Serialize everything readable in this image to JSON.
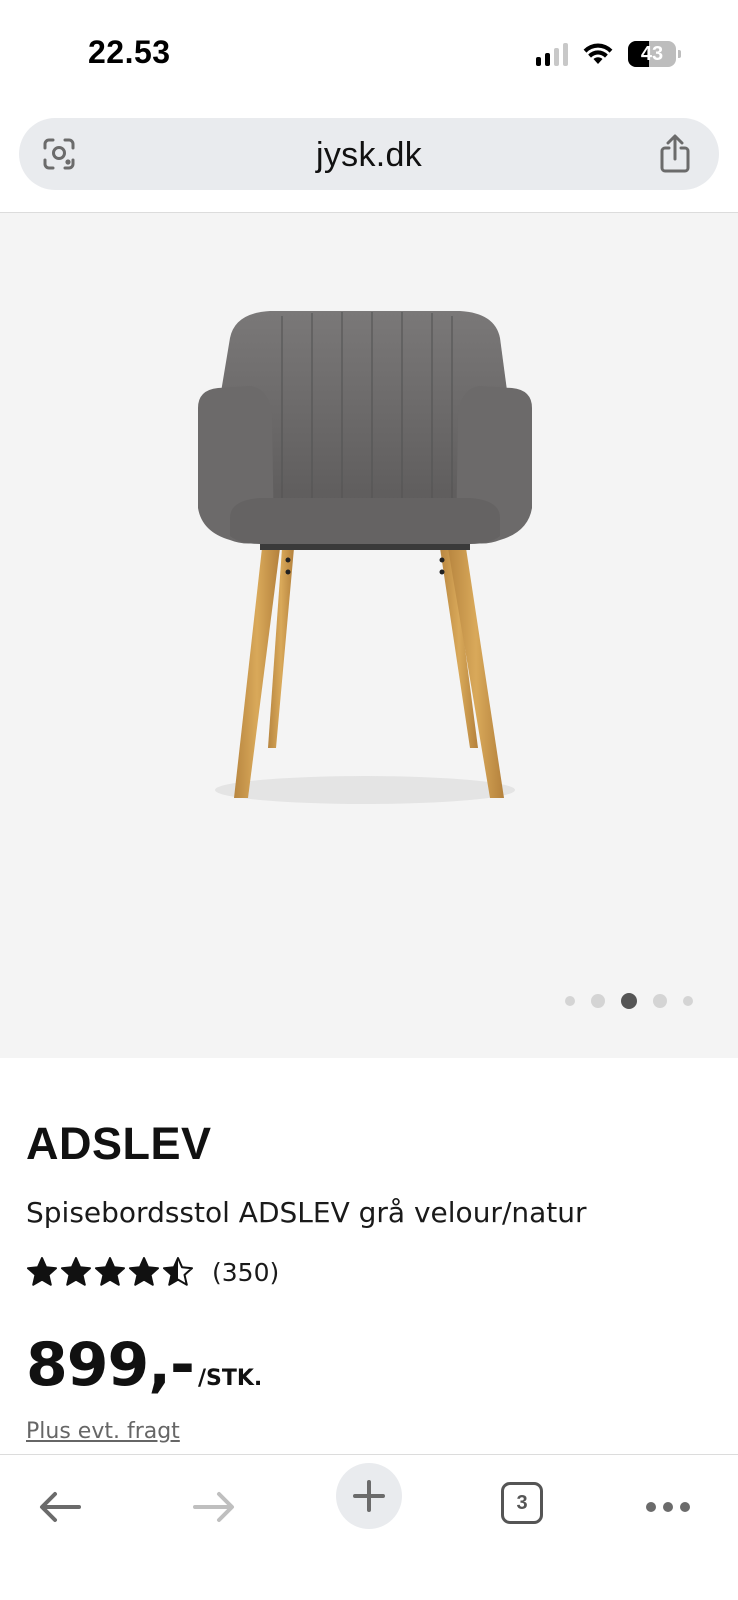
{
  "status_bar": {
    "time": "22.53",
    "battery": "43",
    "battery_level": 0.43,
    "signal_bars_active": 2
  },
  "browser": {
    "url": "jysk.dk",
    "left_icon": "visual-search-icon",
    "right_icon": "share-icon",
    "open_tabs": "3"
  },
  "gallery": {
    "image_count": 5,
    "active_index": 2
  },
  "product": {
    "name": "ADSLEV",
    "description": "Spisebordsstol ADSLEV grå velour/natur",
    "rating_stars": 4.5,
    "rating_count": "(350)",
    "price": "899,-",
    "price_unit": "/STK.",
    "shipping_note": "Plus evt. fragt"
  },
  "toolbar": {
    "back_icon": "arrow-left-icon",
    "forward_icon": "arrow-right-icon",
    "new_tab_icon": "plus-icon",
    "tabs_icon": "tabs-icon",
    "more_icon": "more-icon"
  },
  "colors": {
    "gallery_bg": "#f4f4f4",
    "url_bar_bg": "#e9ebee",
    "dot_active": "#555555",
    "dot_inactive": "#d4d4d4",
    "icon_gray": "#6b6b6b"
  }
}
